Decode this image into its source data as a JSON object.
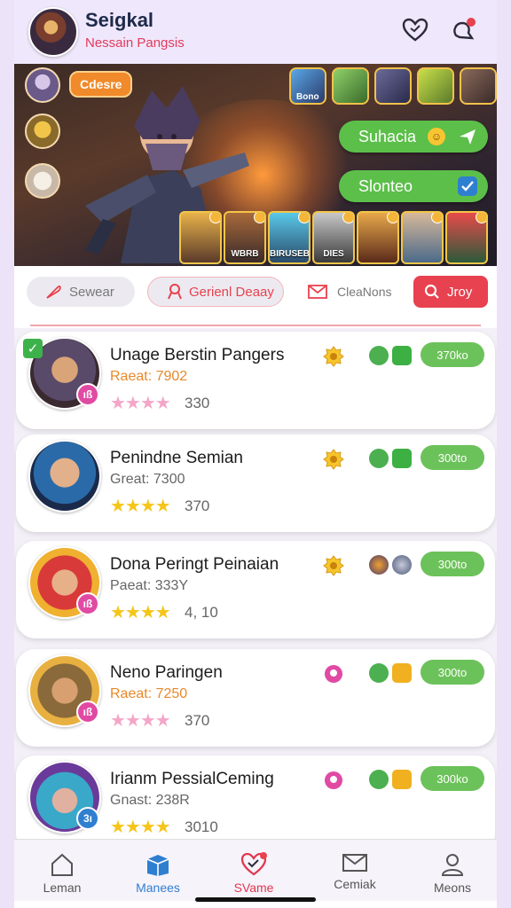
{
  "header": {
    "title": "Seigkal",
    "subtitle": "Nessain Pangsis"
  },
  "hero": {
    "badge": "Cdesre",
    "pill_1": "Suhacia",
    "pill_2": "Slonteo",
    "top_thumbs": [
      "Bono",
      "",
      "",
      "",
      ""
    ],
    "cards": [
      "",
      "WBRB",
      "BIRUSEB",
      "DIES",
      "",
      "",
      ""
    ]
  },
  "filters": {
    "f1": "Sewear",
    "f2": "Gerienl Deaay",
    "f3": "CleaNons",
    "f4": "Jroy"
  },
  "players": [
    {
      "name": "Unage Berstin Pangers",
      "rate": "Raeat: 7902",
      "stars": 4,
      "score": "330",
      "level": "ıß",
      "pill": "370ko",
      "rate_color": "#e8892a",
      "star_color": "#f4a6c8",
      "checked": true
    },
    {
      "name": "Penindne Semian",
      "rate": "Great: 7300",
      "stars": 4,
      "score": "370",
      "level": "",
      "pill": "300to",
      "rate_color": "#666666",
      "star_color": "#f5c518",
      "checked": false
    },
    {
      "name": "Dona Peringt Peinaian",
      "rate": "Paeat: 333Y",
      "stars": 4,
      "score": "4, 10",
      "level": "ıß",
      "pill": "300to",
      "rate_color": "#666666",
      "star_color": "#f5c518",
      "checked": false
    },
    {
      "name": "Neno Paringen",
      "rate": "Raeat: 7250",
      "stars": 4,
      "score": "370",
      "level": "ıß",
      "pill": "300to",
      "rate_color": "#e8892a",
      "star_color": "#f4a6c8",
      "checked": false
    },
    {
      "name": "Irianm PessialCeming",
      "rate": "Gnast: 238R",
      "stars": 4,
      "score": "3010",
      "level": "3ı",
      "pill": "300ko",
      "rate_color": "#666666",
      "star_color": "#f5c518",
      "checked": false
    }
  ],
  "tabs": [
    {
      "label": "Leman"
    },
    {
      "label": "Manees"
    },
    {
      "label": "SVame"
    },
    {
      "label": "Cemiak"
    },
    {
      "label": "Meons"
    }
  ],
  "colors": {
    "accent_red": "#e8414f",
    "green": "#5cbf4a",
    "blue_active": "#2f7fd1",
    "red_active": "#e2364f"
  }
}
